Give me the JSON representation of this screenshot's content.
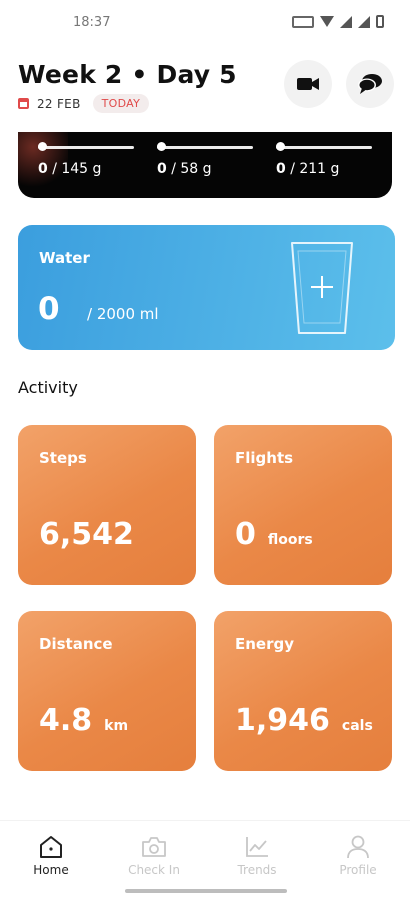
{
  "status_bar": {
    "time": "18:37"
  },
  "header": {
    "title": "Week 2 • Day 5",
    "date": "22 FEB",
    "today_badge": "TODAY",
    "icons": {
      "calendar": "calendar-icon",
      "video": "video-camera-icon",
      "chat": "chat-bubbles-icon"
    }
  },
  "macros": [
    {
      "current": "0",
      "goal": "/ 145 g",
      "progress": 0
    },
    {
      "current": "0",
      "goal": "/ 58 g",
      "progress": 0
    },
    {
      "current": "0",
      "goal": "/ 211 g",
      "progress": 0
    }
  ],
  "water": {
    "title": "Water",
    "current": "0",
    "goal": "/ 2000 ml",
    "icon": "add-water-cup-icon"
  },
  "activity": {
    "title": "Activity",
    "tiles": [
      {
        "label": "Steps",
        "value": "6,542",
        "unit": ""
      },
      {
        "label": "Flights",
        "value": "0",
        "unit": "floors"
      },
      {
        "label": "Distance",
        "value": "4.8",
        "unit": "km"
      },
      {
        "label": "Energy",
        "value": "1,946",
        "unit": "cals"
      }
    ]
  },
  "nav": {
    "items": [
      {
        "label": "Home",
        "icon": "home-icon",
        "active": true
      },
      {
        "label": "Check In",
        "icon": "camera-icon",
        "active": false
      },
      {
        "label": "Trends",
        "icon": "chart-icon",
        "active": false
      },
      {
        "label": "Profile",
        "icon": "profile-icon",
        "active": false
      }
    ]
  },
  "colors": {
    "accent_red": "#e04a4a",
    "water_blue": "#4aaee6",
    "activity_orange": "#ea8847"
  }
}
